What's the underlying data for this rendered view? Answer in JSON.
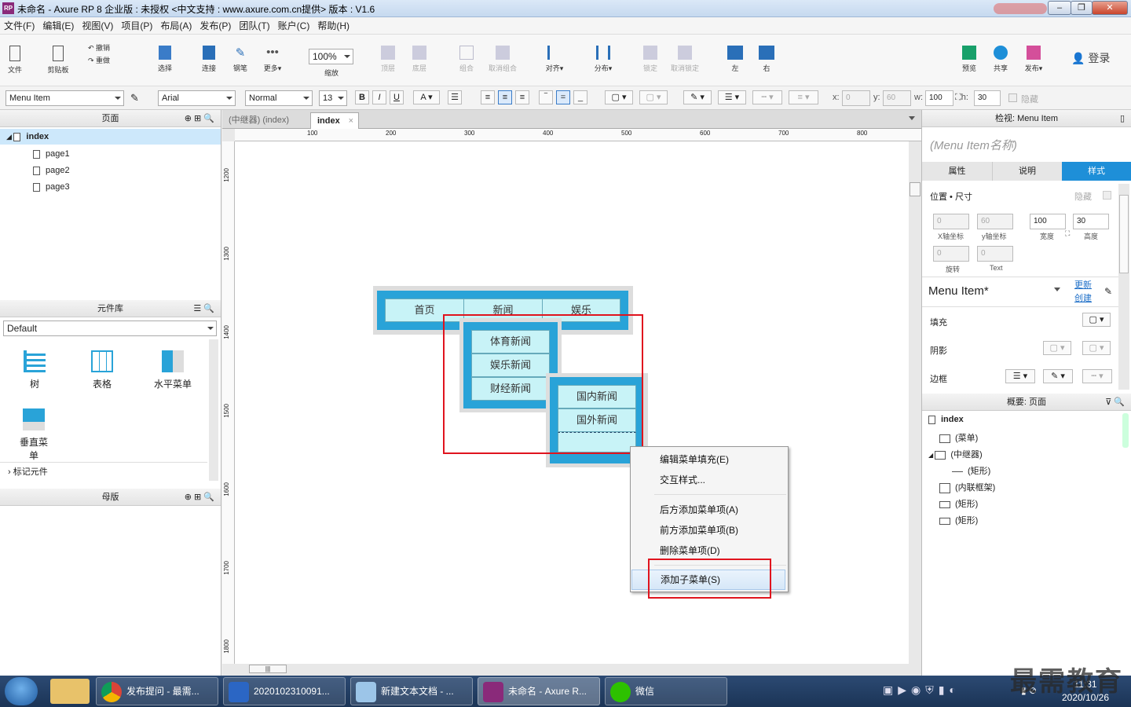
{
  "window": {
    "title": "未命名 - Axure RP 8 企业版 : 未授权     <中文支持 : www.axure.com.cn提供> 版本 : V1.6",
    "logo": "RP"
  },
  "menubar": [
    "文件(F)",
    "编辑(E)",
    "视图(V)",
    "项目(P)",
    "布局(A)",
    "发布(P)",
    "团队(T)",
    "账户(C)",
    "帮助(H)"
  ],
  "toolbar": {
    "file": "文件",
    "clipboard": "剪贴板",
    "undo": "撤销",
    "redo": "重做",
    "select": "选择",
    "connect": "连接",
    "pen": "钢笔",
    "more": "更多▾",
    "zoom_value": "100%",
    "zoom": "缩放",
    "top": "顶层",
    "bottom": "底层",
    "group": "组合",
    "ungroup": "取消组合",
    "align": "对齐▾",
    "distribute": "分布▾",
    "lock": "锁定",
    "unlock": "取消锁定",
    "left": "左",
    "right": "右",
    "preview": "预览",
    "share": "共享",
    "publish": "发布▾",
    "login": "登录"
  },
  "format": {
    "style": "Menu Item",
    "font": "Arial",
    "weight": "Normal",
    "size": "13",
    "x_label": "x:",
    "x": "0",
    "y_label": "y:",
    "y": "60",
    "w_label": "w:",
    "w": "100",
    "h_label": "h:",
    "h": "30",
    "hidden": "隐藏"
  },
  "pages_panel": {
    "title": "页面",
    "items": [
      {
        "label": "index",
        "level": 0
      },
      {
        "label": "page1",
        "level": 1
      },
      {
        "label": "page2",
        "level": 1
      },
      {
        "label": "page3",
        "level": 1
      }
    ]
  },
  "library_panel": {
    "title": "元件库",
    "selected": "Default",
    "widgets": [
      "树",
      "表格",
      "水平菜单",
      "垂直菜单"
    ],
    "markup": "标记元件"
  },
  "masters_panel": {
    "title": "母版"
  },
  "tabs": [
    "(中继器) (index)",
    "index"
  ],
  "ruler_h": [
    "100",
    "200",
    "300",
    "400",
    "500",
    "600",
    "700",
    "800"
  ],
  "ruler_v": [
    "1200",
    "1300",
    "1400",
    "1500",
    "1600",
    "1700",
    "1800"
  ],
  "menu_widget": {
    "top": [
      "首页",
      "新闻",
      "娱乐"
    ],
    "sub1": [
      "体育新闻",
      "娱乐新闻",
      "财经新闻"
    ],
    "sub2": [
      "国内新闻",
      "国外新闻"
    ]
  },
  "context_menu": {
    "items": [
      "编辑菜单填充(E)",
      "交互样式...",
      "后方添加菜单项(A)",
      "前方添加菜单项(B)",
      "删除菜单项(D)",
      "添加子菜单(S)"
    ]
  },
  "inspector": {
    "title": "检视: Menu Item",
    "name_placeholder": "(Menu Item名称)",
    "tabs": [
      "属性",
      "说明",
      "样式"
    ],
    "section": "位置 • 尺寸",
    "hidden": "隐藏",
    "x": "0",
    "y": "60",
    "w": "100",
    "h": "30",
    "x_lbl": "X轴坐标",
    "y_lbl": "y轴坐标",
    "w_lbl": "宽度",
    "h_lbl": "高度",
    "rot": "0",
    "text_rot": "0",
    "rot_lbl": "旋转",
    "text_lbl": "Text",
    "style_name": "Menu Item*",
    "update": "更新",
    "create": "创建",
    "fill": "填充",
    "shadow": "阴影",
    "border": "边框"
  },
  "outline": {
    "title": "概要: 页面",
    "items": [
      "index",
      "(菜单)",
      "(中继器)",
      "(矩形)",
      "(内联框架)",
      "(矩形)",
      "(矩形)"
    ]
  },
  "taskbar": {
    "apps": [
      "发布提问 - 最需...",
      "2020102310091...",
      "新建文本文档 - ...",
      "未命名 - Axure R...",
      "微信"
    ],
    "time": "11:31",
    "date": "2020/10/26",
    "watermark": "最需教育"
  },
  "colors": {
    "menu_blue": "#29a3d8",
    "menu_cell": "#c8f3f7",
    "highlight": "#e0141e",
    "accent": "#1e8fd8"
  }
}
